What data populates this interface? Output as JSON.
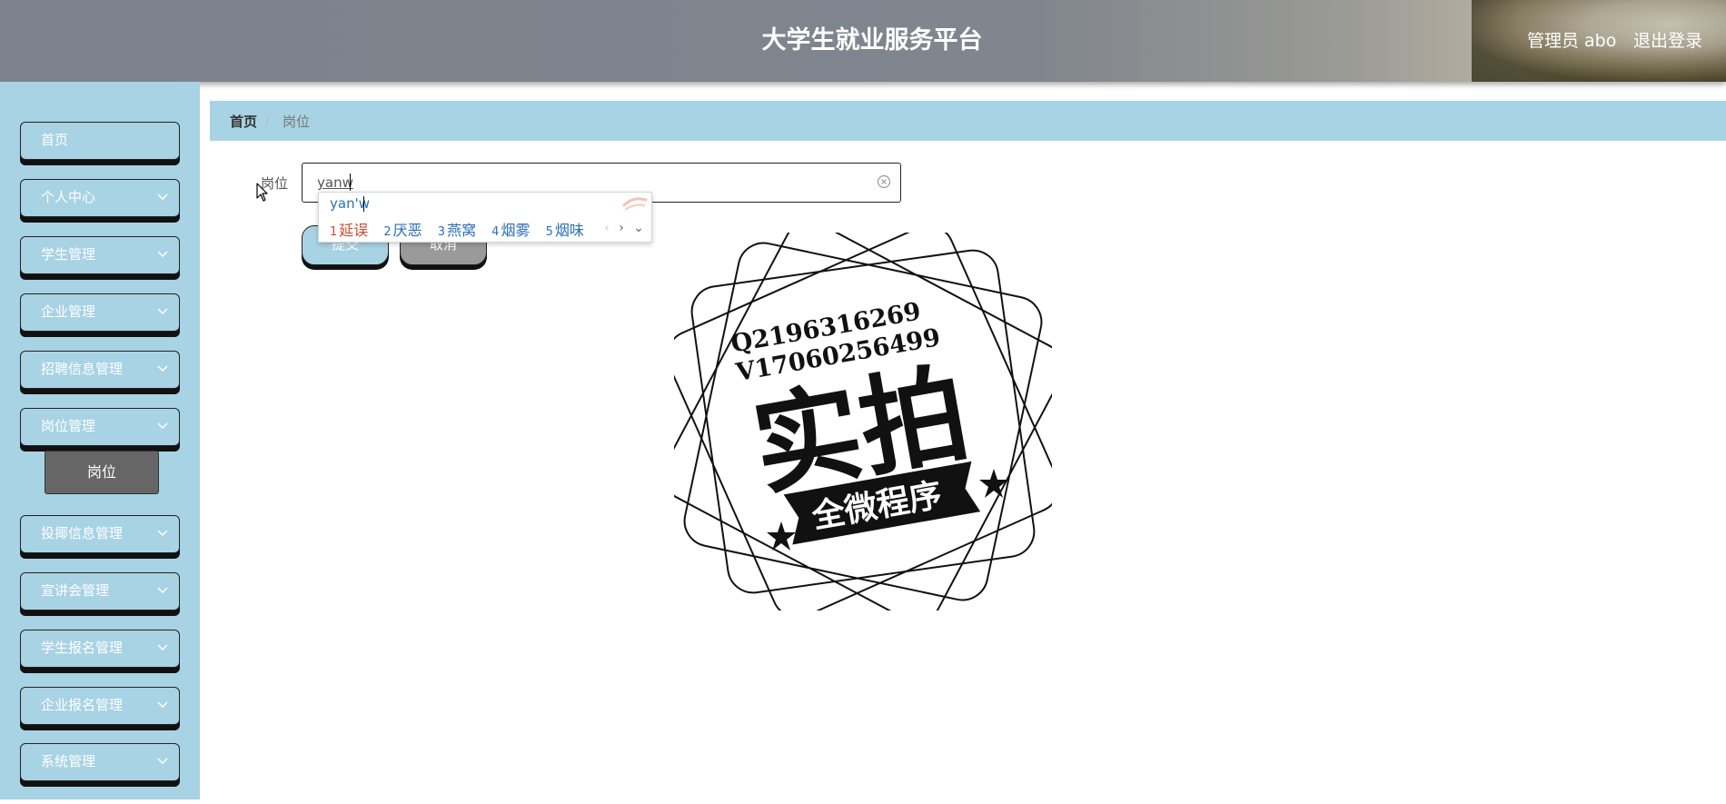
{
  "header": {
    "title": "大学生就业服务平台",
    "user_label": "管理员 abo",
    "logout_label": "退出登录"
  },
  "sidebar": {
    "items": [
      {
        "label": "首页"
      },
      {
        "label": "个人中心"
      },
      {
        "label": "学生管理"
      },
      {
        "label": "企业管理"
      },
      {
        "label": "招聘信息管理"
      },
      {
        "label": "岗位管理"
      },
      {
        "label": "投揶信息管理"
      },
      {
        "label": "宣讲会管理"
      },
      {
        "label": "学生报名管理"
      },
      {
        "label": "企业报名管理"
      },
      {
        "label": "系统管理"
      }
    ],
    "active_sub": "岗位"
  },
  "breadcrumb": {
    "home": "首页",
    "separator": "/",
    "current": "岗位"
  },
  "form": {
    "label": "岗位",
    "input_value": "yanw",
    "submit_label": "提交",
    "cancel_label": "取消"
  },
  "ime": {
    "composition": "yan'w",
    "candidates": [
      {
        "num": "1",
        "text": "延误"
      },
      {
        "num": "2",
        "text": "厌恶"
      },
      {
        "num": "3",
        "text": "燕窝"
      },
      {
        "num": "4",
        "text": "烟雾"
      },
      {
        "num": "5",
        "text": "烟味"
      }
    ],
    "nav_prev": "‹",
    "nav_next": "›",
    "nav_expand": "⌄"
  },
  "watermark": {
    "line1": "Q2196316269",
    "line2": "V17060256499",
    "big": "实拍",
    "banner": "全微程序"
  },
  "colors": {
    "sidebar_bg": "#a8d3e4",
    "header_bg": "#80868e",
    "sub_active_bg": "#666666",
    "ime_first": "#d24a2c",
    "ime_text": "#2a6fb8"
  }
}
